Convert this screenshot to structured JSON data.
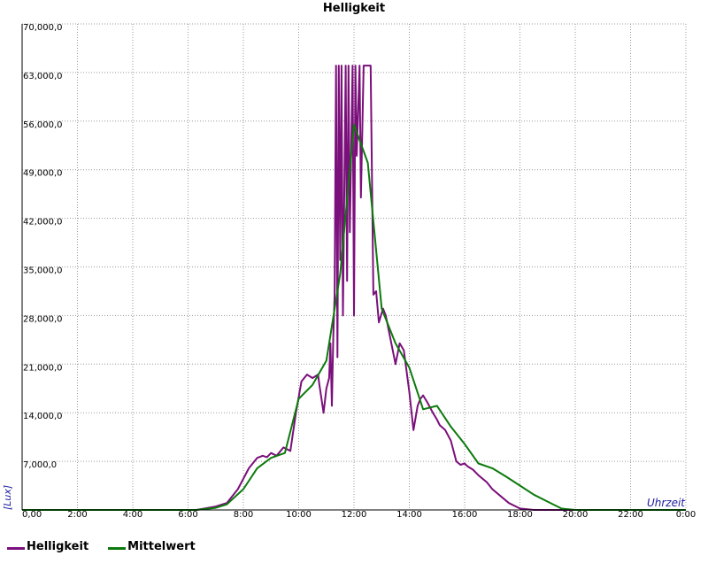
{
  "chart_data": {
    "type": "line",
    "title": "Helligkeit",
    "xlabel": "Uhrzeit",
    "ylabel": "[Lux]",
    "x_ticks": [
      "0,00",
      "2:00",
      "4:00",
      "6:00",
      "8:00",
      "10:00",
      "12:00",
      "14:00",
      "16:00",
      "18:00",
      "20:00",
      "22:00",
      "0:00"
    ],
    "y_ticks": [
      "7,000,0",
      "14,000,0",
      "21,000,0",
      "28,000,0",
      "35,000,0",
      "42,000,0",
      "49,000,0",
      "56,000,0",
      "63,000,0",
      "70,000,0"
    ],
    "xlim": [
      0,
      24
    ],
    "ylim": [
      0,
      70000
    ],
    "grid": true,
    "legend_position": "bottom-left",
    "series": [
      {
        "name": "Helligkeit",
        "color": "#7b0f7b",
        "x": [
          0,
          6.3,
          7.0,
          7.4,
          7.8,
          8.2,
          8.5,
          8.7,
          8.85,
          9.0,
          9.2,
          9.45,
          9.7,
          9.9,
          10.1,
          10.3,
          10.5,
          10.7,
          10.75,
          10.9,
          11.0,
          11.1,
          11.15,
          11.2,
          11.25,
          11.3,
          11.35,
          11.4,
          11.45,
          11.5,
          11.55,
          11.6,
          11.7,
          11.75,
          11.8,
          11.85,
          11.95,
          12.0,
          12.05,
          12.1,
          12.2,
          12.25,
          12.35,
          12.4,
          12.6,
          12.7,
          12.8,
          12.9,
          13.05,
          13.15,
          13.3,
          13.5,
          13.65,
          13.8,
          13.9,
          14.0,
          14.15,
          14.3,
          14.4,
          14.5,
          14.65,
          14.85,
          15.0,
          15.1,
          15.3,
          15.5,
          15.7,
          15.85,
          16.0,
          16.1,
          16.3,
          16.5,
          16.8,
          17.0,
          17.3,
          17.6,
          18.0,
          18.5,
          19.0,
          19.4,
          19.8,
          20.1,
          20.5,
          24
        ],
        "values": [
          0,
          0,
          500,
          1000,
          3000,
          6000,
          7500,
          7800,
          7600,
          8200,
          7800,
          9000,
          8500,
          14000,
          18500,
          19500,
          19000,
          19500,
          18000,
          14000,
          17500,
          19000,
          24000,
          15000,
          25000,
          31000,
          64000,
          22000,
          64000,
          36000,
          64000,
          28000,
          64000,
          33000,
          64000,
          40000,
          64000,
          28000,
          64000,
          51000,
          64000,
          45000,
          64000,
          64000,
          64000,
          31000,
          31500,
          27000,
          29000,
          28000,
          25000,
          21000,
          24000,
          23000,
          20000,
          17000,
          11500,
          15000,
          16000,
          16500,
          15500,
          14000,
          13000,
          12200,
          11500,
          10000,
          7000,
          6500,
          6700,
          6300,
          5800,
          5000,
          4000,
          3000,
          2000,
          1000,
          200,
          0,
          0,
          0,
          0,
          0,
          0,
          0
        ]
      },
      {
        "name": "Mittelwert",
        "color": "#0c7a0c",
        "x": [
          0,
          6.3,
          7.0,
          7.4,
          8.0,
          8.5,
          9.0,
          9.5,
          10.0,
          10.5,
          11.0,
          11.5,
          12.0,
          12.5,
          13.0,
          13.5,
          14.0,
          14.5,
          15.0,
          15.5,
          16.0,
          16.5,
          17.0,
          17.5,
          18.0,
          18.5,
          19.0,
          19.5,
          20.0,
          20.5,
          24
        ],
        "values": [
          0,
          0,
          300,
          800,
          3000,
          6000,
          7500,
          8200,
          16000,
          18000,
          21500,
          34000,
          55500,
          50000,
          29000,
          24000,
          20500,
          14500,
          15000,
          12000,
          9500,
          6700,
          6000,
          4800,
          3500,
          2200,
          1200,
          200,
          0,
          0,
          0
        ]
      }
    ]
  }
}
